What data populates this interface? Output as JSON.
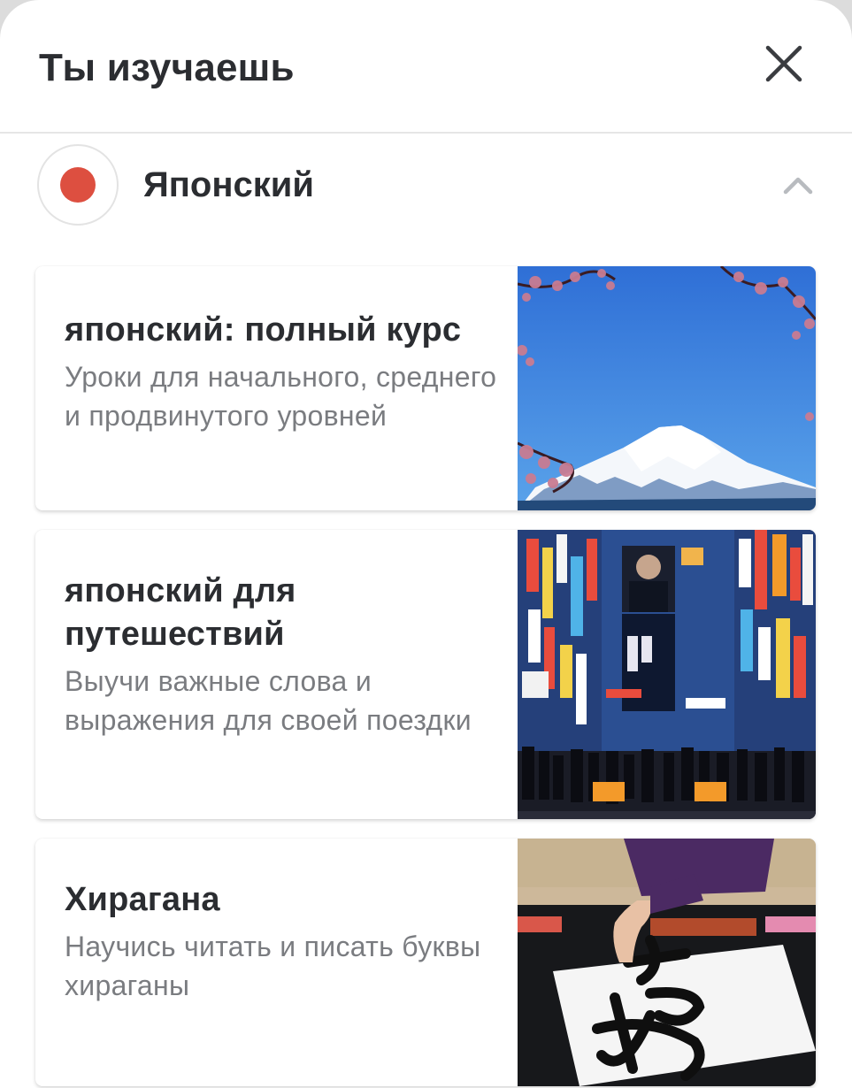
{
  "header": {
    "title": "Ты изучаешь",
    "close_icon": "close-icon"
  },
  "language": {
    "name": "Японский",
    "flag_icon": "japan-flag-icon",
    "flag_color": "#dd4f40",
    "chevron_icon": "chevron-up-icon"
  },
  "courses": [
    {
      "title": "японский: полный курс",
      "description": "Уроки для начального, среднего и продвинутого уровней",
      "image": "mount-fuji-photo"
    },
    {
      "title": "японский для путешествий",
      "description": "Выучи важные слова и выражения для своей поездки",
      "image": "tokyo-street-night-photo"
    },
    {
      "title": "Хирагана",
      "description": "Научись читать и писать буквы хираганы",
      "image": "calligraphy-photo"
    }
  ]
}
